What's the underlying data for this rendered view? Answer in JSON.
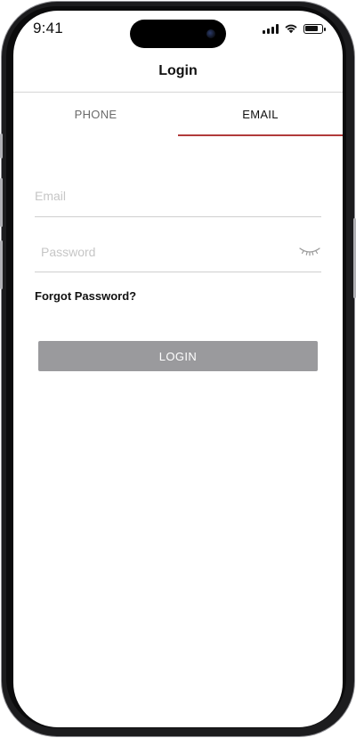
{
  "status_bar": {
    "time": "9:41",
    "battery_level": 0.9
  },
  "header": {
    "title": "Login"
  },
  "tabs": [
    {
      "label": "PHONE",
      "active": false
    },
    {
      "label": "EMAIL",
      "active": true
    }
  ],
  "form": {
    "email_placeholder": "Email",
    "email_value": "",
    "password_placeholder": "Password",
    "password_value": "",
    "forgot_password_label": "Forgot Password?",
    "login_button_label": "LOGIN"
  },
  "colors": {
    "accent": "#b13a3a",
    "button_disabled": "#9a9a9d",
    "placeholder": "#c6c6c6"
  },
  "icons": {
    "password_toggle": "eye-closed-icon"
  }
}
